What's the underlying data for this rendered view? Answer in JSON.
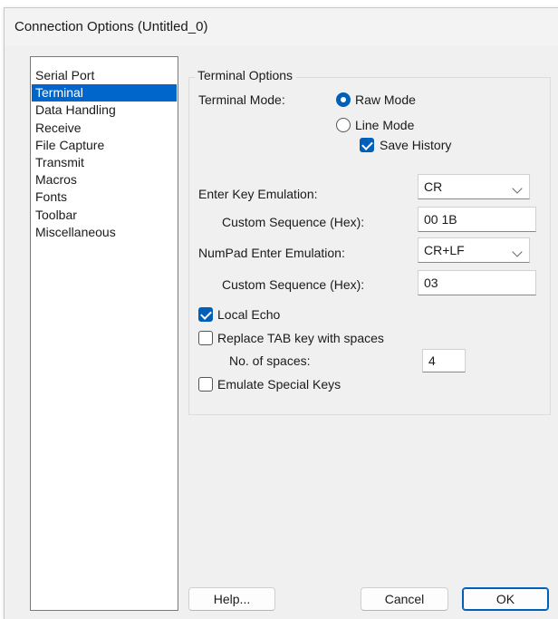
{
  "window": {
    "title": "Connection Options (Untitled_0)"
  },
  "sidebar": {
    "items": [
      {
        "label": "Serial Port",
        "selected": false
      },
      {
        "label": "Terminal",
        "selected": true
      },
      {
        "label": "Data Handling",
        "selected": false
      },
      {
        "label": "Receive",
        "selected": false
      },
      {
        "label": "File Capture",
        "selected": false
      },
      {
        "label": "Transmit",
        "selected": false
      },
      {
        "label": "Macros",
        "selected": false
      },
      {
        "label": "Fonts",
        "selected": false
      },
      {
        "label": "Toolbar",
        "selected": false
      },
      {
        "label": "Miscellaneous",
        "selected": false
      }
    ]
  },
  "terminal_options": {
    "group_label": "Terminal Options",
    "terminal_mode_label": "Terminal Mode:",
    "raw_mode_label": "Raw Mode",
    "raw_mode_selected": true,
    "line_mode_label": "Line Mode",
    "line_mode_selected": false,
    "save_history_label": "Save History",
    "save_history_checked": true,
    "enter_key_label": "Enter Key Emulation:",
    "enter_key_value": "CR",
    "custom_seq_label_1": "Custom Sequence (Hex):",
    "custom_seq_value_1": "00 1B",
    "numpad_enter_label": "NumPad Enter Emulation:",
    "numpad_enter_value": "CR+LF",
    "custom_seq_label_2": "Custom Sequence (Hex):",
    "custom_seq_value_2": "03",
    "local_echo_label": "Local Echo",
    "local_echo_checked": true,
    "replace_tab_label": "Replace TAB key with spaces",
    "replace_tab_checked": false,
    "num_spaces_label": "No. of spaces:",
    "num_spaces_value": "4",
    "emulate_special_label": "Emulate Special Keys",
    "emulate_special_checked": false
  },
  "buttons": {
    "help": "Help...",
    "cancel": "Cancel",
    "ok": "OK"
  },
  "colors": {
    "accent": "#005fb8",
    "selection": "#0066cc",
    "dialog_bg": "#f0f0f0"
  }
}
